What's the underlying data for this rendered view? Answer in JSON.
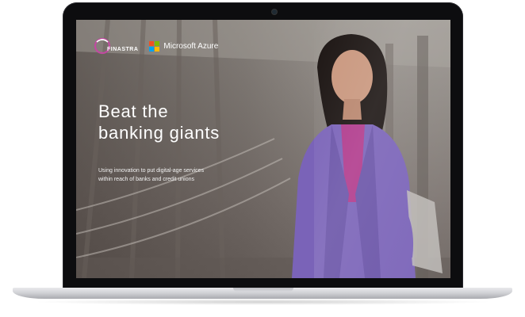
{
  "slide": {
    "brand_primary": "FINASTRA",
    "brand_secondary": "Microsoft Azure",
    "headline_line1": "Beat the",
    "headline_line2": "banking giants",
    "subtitle_line1": "Using innovation to put digital-age services",
    "subtitle_line2": "within reach of banks and credit unions"
  },
  "colors": {
    "accent_purple": "#7a63b8",
    "magenta_top": "#b03a8c",
    "ms_red": "#f25022",
    "ms_green": "#7fba00",
    "ms_blue": "#00a4ef",
    "ms_yellow": "#ffb900"
  },
  "icons": [
    "finastra-logo-icon",
    "microsoft-logo-icon",
    "camera-icon"
  ]
}
